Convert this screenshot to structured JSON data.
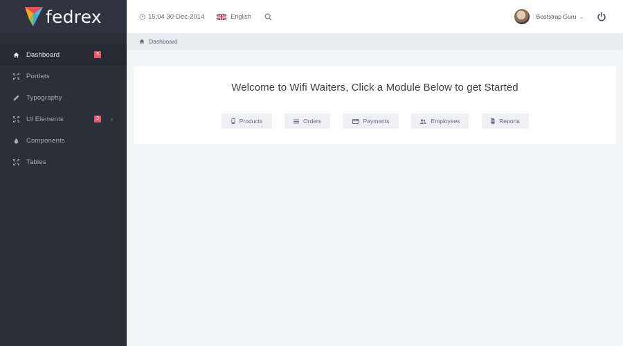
{
  "brand": {
    "name": "fedrex",
    "colors": [
      "#e84d5b",
      "#f5a623",
      "#4fc1e9",
      "#8cc152"
    ]
  },
  "sidebar": {
    "items": [
      {
        "label": "Dashboard",
        "icon": "home-icon",
        "active": true,
        "badge": "3"
      },
      {
        "label": "Portlets",
        "icon": "expand-icon"
      },
      {
        "label": "Typography",
        "icon": "pencil-icon"
      },
      {
        "label": "UI Elements",
        "icon": "expand-icon",
        "badge": "3",
        "chevron": "›"
      },
      {
        "label": "Components",
        "icon": "drop-icon"
      },
      {
        "label": "Tables",
        "icon": "expand-icon"
      }
    ]
  },
  "header": {
    "datetime": "15:04 30-Dec-2014",
    "language": "English",
    "user_name": "Bootstrap Guru",
    "user_caret": "⌄"
  },
  "breadcrumb": {
    "current": "Dashboard"
  },
  "panel": {
    "welcome": "Welcome to Wifi Waiters, Click a Module Below to get Started",
    "modules": [
      {
        "label": "Products",
        "icon": "phone-icon"
      },
      {
        "label": "Orders",
        "icon": "list-icon"
      },
      {
        "label": "Payments",
        "icon": "card-icon"
      },
      {
        "label": "Employees",
        "icon": "users-icon"
      },
      {
        "label": "Reports",
        "icon": "document-icon"
      }
    ]
  },
  "colors": {
    "sidebar_bg": "#2b2f3a",
    "badge": "#e85a6a",
    "content_bg": "#f4f5f8"
  }
}
